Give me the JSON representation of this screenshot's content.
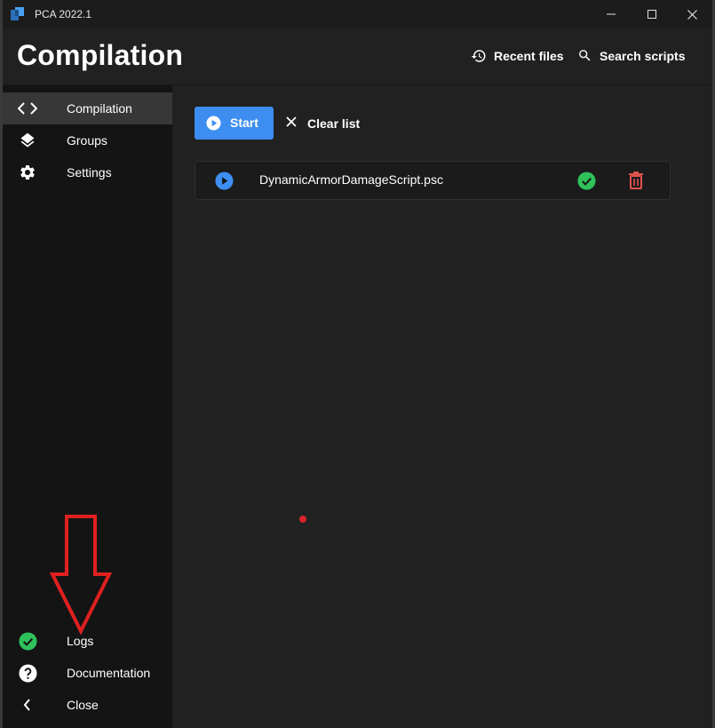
{
  "titlebar": {
    "app_title": "PCA 2022.1",
    "buttons": [
      {
        "icon": "minimize-icon"
      },
      {
        "icon": "maximize-icon"
      },
      {
        "icon": "close-icon"
      }
    ]
  },
  "header": {
    "title": "Compilation",
    "recent_files_label": "Recent files",
    "recent_files_icon": "history-icon",
    "search_scripts_label": "Search scripts",
    "search_scripts_icon": "search-icon"
  },
  "sidebar": {
    "top_items": [
      {
        "label": "Compilation",
        "icon": "code-brackets-icon",
        "active": true
      },
      {
        "label": "Groups",
        "icon": "layers-icon",
        "active": false
      },
      {
        "label": "Settings",
        "icon": "gear-icon",
        "active": false
      }
    ],
    "bottom_items": [
      {
        "label": "Logs",
        "icon": "check-circle-icon"
      },
      {
        "label": "Documentation",
        "icon": "help-circle-icon"
      },
      {
        "label": "Close",
        "icon": "chevron-left-icon"
      }
    ]
  },
  "main": {
    "start_label": "Start",
    "clear_label": "Clear list",
    "scripts": [
      {
        "name": "DynamicArmorDamageScript.psc",
        "status": "success"
      }
    ]
  },
  "colors": {
    "accent": "#3d8ef0",
    "success": "#2fc25b",
    "delete": "#e0524f",
    "annotation": "#e02020"
  }
}
